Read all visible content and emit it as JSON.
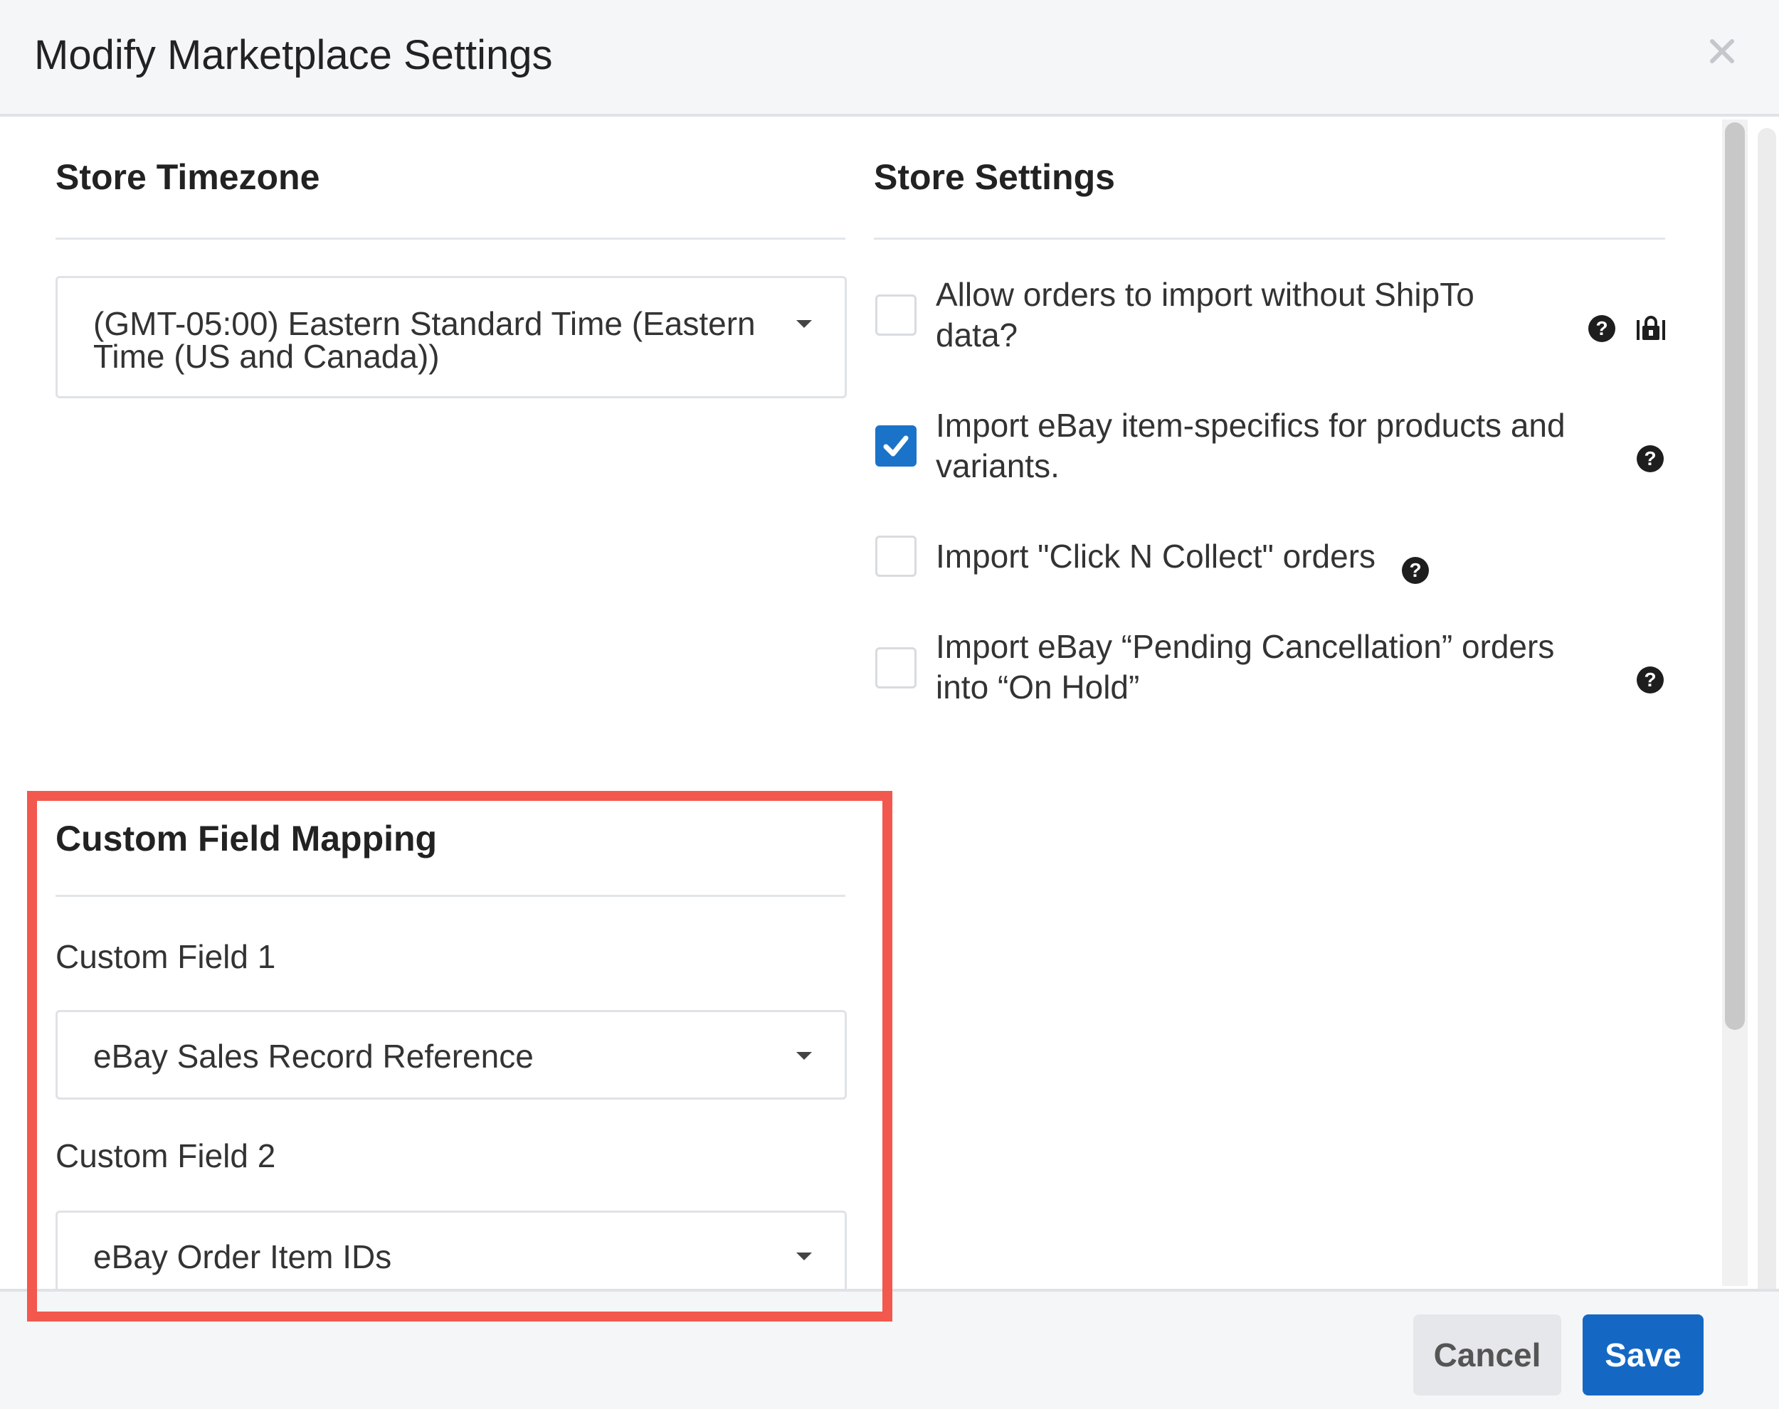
{
  "modal": {
    "title": "Modify Marketplace Settings",
    "close_icon": "close-icon"
  },
  "timezone": {
    "heading": "Store Timezone",
    "selected_line1": "(GMT-05:00) Eastern Standard Time (Eastern",
    "selected_line2": "Time (US and Canada))"
  },
  "store_settings": {
    "heading": "Store Settings",
    "options": [
      {
        "line1": "Allow orders to import without ShipTo",
        "line2": "data?",
        "checked": false,
        "icons": [
          "help-icon",
          "lock-icon"
        ]
      },
      {
        "line1": "Import eBay item-specifics for products and",
        "line2": "variants.",
        "checked": true,
        "icons": [
          "help-icon"
        ]
      },
      {
        "line1": "Import \"Click N Collect\" orders",
        "line2": "",
        "checked": false,
        "icons": [
          "help-icon"
        ]
      },
      {
        "line1": "Import eBay “Pending Cancellation” orders",
        "line2": "into “On Hold”",
        "checked": false,
        "icons": [
          "help-icon"
        ]
      }
    ]
  },
  "custom_field_mapping": {
    "heading": "Custom Field Mapping",
    "field1_label": "Custom Field 1",
    "field1_value": "eBay Sales Record Reference",
    "field2_label": "Custom Field 2",
    "field2_value": "eBay Order Item IDs"
  },
  "footer": {
    "cancel_label": "Cancel",
    "save_label": "Save"
  },
  "colors": {
    "accent": "#1468c4",
    "highlight": "#f2584e",
    "header_bg": "#f4f6f8"
  }
}
